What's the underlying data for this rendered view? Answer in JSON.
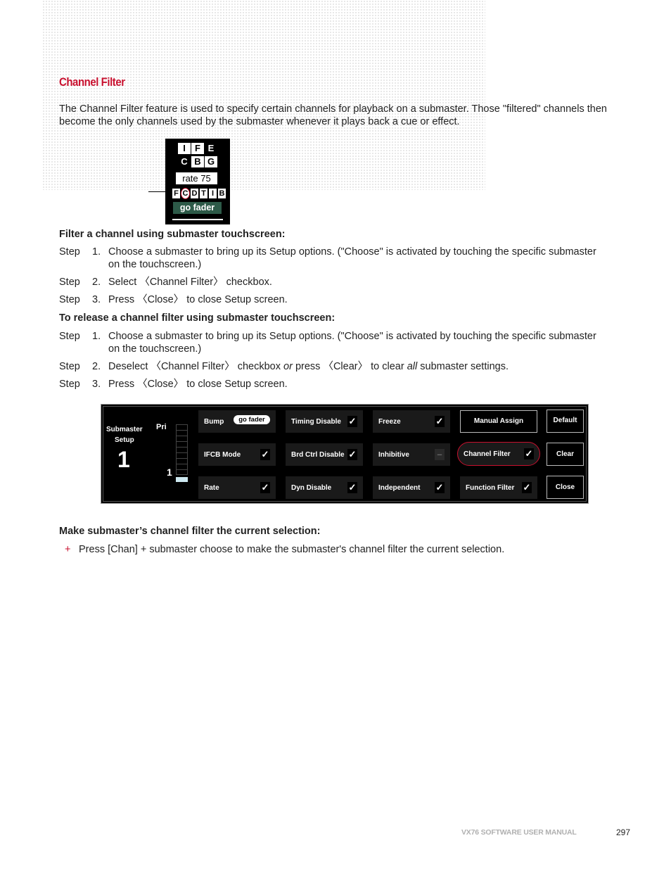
{
  "section_title": "Channel Filter",
  "intro": "The Channel Filter feature is used to specify certain channels for playback on a submaster. Those \"filtered\" channels then become the only channels used by the submaster whenever it plays back a cue or effect.",
  "mini_screen": {
    "row1": [
      "I",
      "F",
      "E"
    ],
    "row2": [
      "C",
      "B",
      "G"
    ],
    "rate": "rate 75",
    "filters": [
      "F",
      "C",
      "D",
      "T",
      "I",
      "B"
    ],
    "highlighted_filter": "C",
    "go_fader": "go fader"
  },
  "procedure1": {
    "heading": "Filter a channel using submaster touchscreen:",
    "steps": [
      {
        "label": "Step",
        "num": "1.",
        "text": "Choose a submaster to bring up its Setup options. (\"Choose\" is activated by touching the specific submaster on the touchscreen.)"
      },
      {
        "label": "Step",
        "num": "2.",
        "text": "Select 〈Channel Filter〉 checkbox."
      },
      {
        "label": "Step",
        "num": "3.",
        "text": "Press 〈Close〉 to close Setup screen."
      }
    ]
  },
  "procedure2": {
    "heading": "To release a channel filter using submaster touchscreen:",
    "steps": [
      {
        "label": "Step",
        "num": "1.",
        "text": "Choose a submaster to bring up its Setup options. (\"Choose\" is activated by touching the specific submaster on the touchscreen.)"
      },
      {
        "label": "Step",
        "num": "2.",
        "text_parts": [
          "Deselect 〈Channel Filter〉 checkbox ",
          "or",
          " press 〈Clear〉 to clear ",
          "all",
          " submaster settings."
        ]
      },
      {
        "label": "Step",
        "num": "3.",
        "text": "Press 〈Close〉 to close Setup screen."
      }
    ]
  },
  "setup_panel": {
    "title_line1": "Submaster",
    "title_line2": "Setup",
    "submaster_number": "1",
    "pri_label": "Pri",
    "pri_value": "1",
    "bump": {
      "label": "Bump",
      "value": "go fader"
    },
    "options": [
      {
        "label": "IFCB Mode",
        "state": "✓"
      },
      {
        "label": "Rate",
        "state": "✓"
      },
      {
        "label": "Timing Disable",
        "state": "✓"
      },
      {
        "label": "Brd Ctrl Disable",
        "state": "✓"
      },
      {
        "label": "Dyn Disable",
        "state": "✓"
      },
      {
        "label": "Freeze",
        "state": "✓"
      },
      {
        "label": "Inhibitive",
        "state": "–"
      },
      {
        "label": "Independent",
        "state": "✓"
      },
      {
        "label": "Channel Filter",
        "state": "✓"
      },
      {
        "label": "Function Filter",
        "state": "✓"
      }
    ],
    "manual_assign": "Manual Assign",
    "default": "Default",
    "clear": "Clear",
    "close": "Close"
  },
  "procedure3": {
    "heading": "Make submaster’s channel filter the current selection:",
    "bullet": "+",
    "text": "Press [Chan] + submaster choose to make the submaster's channel filter the current selection."
  },
  "footer": {
    "manual": "VX76 SOFTWARE USER MANUAL",
    "page": "297"
  }
}
